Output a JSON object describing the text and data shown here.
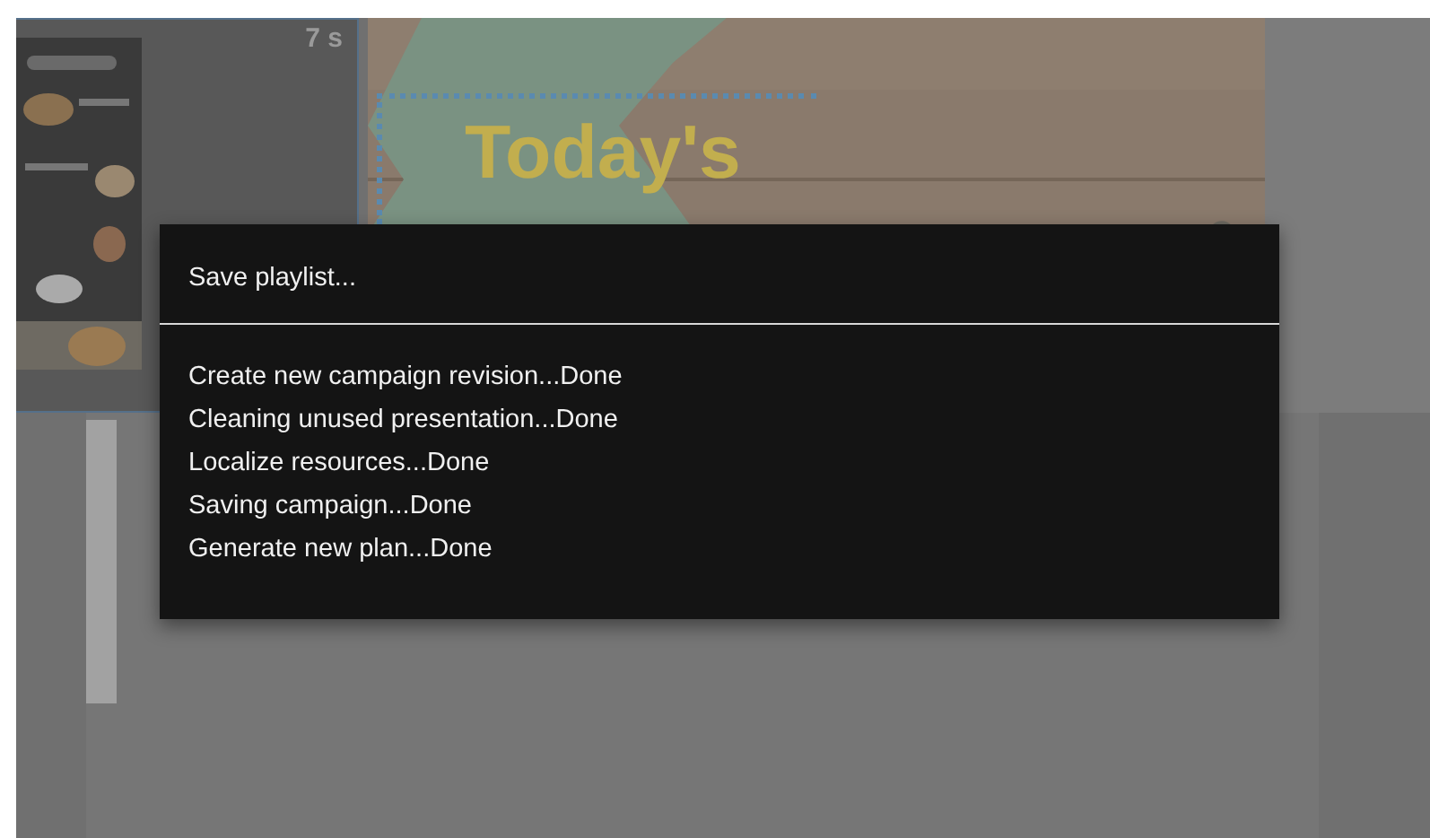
{
  "editor": {
    "slide_duration": "7 s",
    "headline": "Today's"
  },
  "dialog": {
    "title": "Save playlist...",
    "steps": [
      "Create new campaign revision...Done",
      "Cleaning unused presentation...Done",
      "Localize resources...Done",
      "Saving campaign...Done",
      "Generate new plan...Done"
    ]
  }
}
